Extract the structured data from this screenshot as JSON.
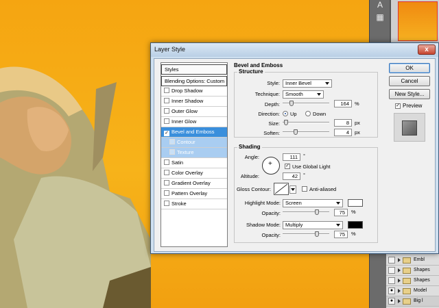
{
  "dialog": {
    "title": "Layer Style",
    "close_glyph": "x"
  },
  "styles_panel": {
    "header": "Styles",
    "items": [
      {
        "label": "Blending Options: Custom",
        "checkbox": false,
        "checked": false
      },
      {
        "label": "Drop Shadow",
        "checkbox": true,
        "checked": false
      },
      {
        "label": "Inner Shadow",
        "checkbox": true,
        "checked": false
      },
      {
        "label": "Outer Glow",
        "checkbox": true,
        "checked": false
      },
      {
        "label": "Inner Glow",
        "checkbox": true,
        "checked": false
      },
      {
        "label": "Bevel and Emboss",
        "checkbox": true,
        "checked": true,
        "active": true
      },
      {
        "label": "Contour",
        "checkbox": true,
        "checked": false,
        "sub": true
      },
      {
        "label": "Texture",
        "checkbox": true,
        "checked": false,
        "sub": true
      },
      {
        "label": "Satin",
        "checkbox": true,
        "checked": false
      },
      {
        "label": "Color Overlay",
        "checkbox": true,
        "checked": false
      },
      {
        "label": "Gradient Overlay",
        "checkbox": true,
        "checked": false
      },
      {
        "label": "Pattern Overlay",
        "checkbox": true,
        "checked": false
      },
      {
        "label": "Stroke",
        "checkbox": true,
        "checked": false
      }
    ]
  },
  "bevel": {
    "section_title": "Bevel and Emboss",
    "structure": {
      "title": "Structure",
      "style_label": "Style:",
      "style_value": "Inner Bevel",
      "technique_label": "Technique:",
      "technique_value": "Smooth",
      "depth_label": "Depth:",
      "depth_value": "164",
      "depth_unit": "%",
      "depth_fraction": 0.164,
      "direction_label": "Direction:",
      "direction_up": "Up",
      "direction_down": "Down",
      "direction_selected": "Up",
      "size_label": "Size:",
      "size_value": "8",
      "size_unit": "px",
      "size_fraction": 0.03,
      "soften_label": "Soften:",
      "soften_value": "4",
      "soften_unit": "px",
      "soften_fraction": 0.25
    },
    "shading": {
      "title": "Shading",
      "angle_label": "Angle:",
      "angle_value": "111",
      "angle_unit": "°",
      "global_light_label": "Use Global Light",
      "global_light_checked": true,
      "altitude_label": "Altitude:",
      "altitude_value": "42",
      "altitude_unit": "°",
      "gloss_label": "Gloss Contour:",
      "anti_aliased_label": "Anti-aliased",
      "anti_aliased_checked": false,
      "highlight_mode_label": "Highlight Mode:",
      "highlight_mode_value": "Screen",
      "highlight_color": "#ffffff",
      "highlight_opacity_label": "Opacity:",
      "highlight_opacity_value": "75",
      "highlight_opacity_unit": "%",
      "highlight_opacity_fraction": 0.75,
      "shadow_mode_label": "Shadow Mode:",
      "shadow_mode_value": "Multiply",
      "shadow_color": "#000000",
      "shadow_opacity_label": "Opacity:",
      "shadow_opacity_value": "75",
      "shadow_opacity_unit": "%",
      "shadow_opacity_fraction": 0.75
    }
  },
  "buttons": {
    "ok": "OK",
    "cancel": "Cancel",
    "new_style": "New Style...",
    "preview": "Preview",
    "preview_checked": true
  },
  "layers": [
    {
      "name": "Embl",
      "visible": false
    },
    {
      "name": "Shapes",
      "visible": false
    },
    {
      "name": "Shapes",
      "visible": false
    },
    {
      "name": "Model",
      "visible": true
    },
    {
      "name": "Big l",
      "visible": true
    }
  ],
  "colors": {
    "accent": "#3a8fdc",
    "canvas": "#f5a511"
  }
}
